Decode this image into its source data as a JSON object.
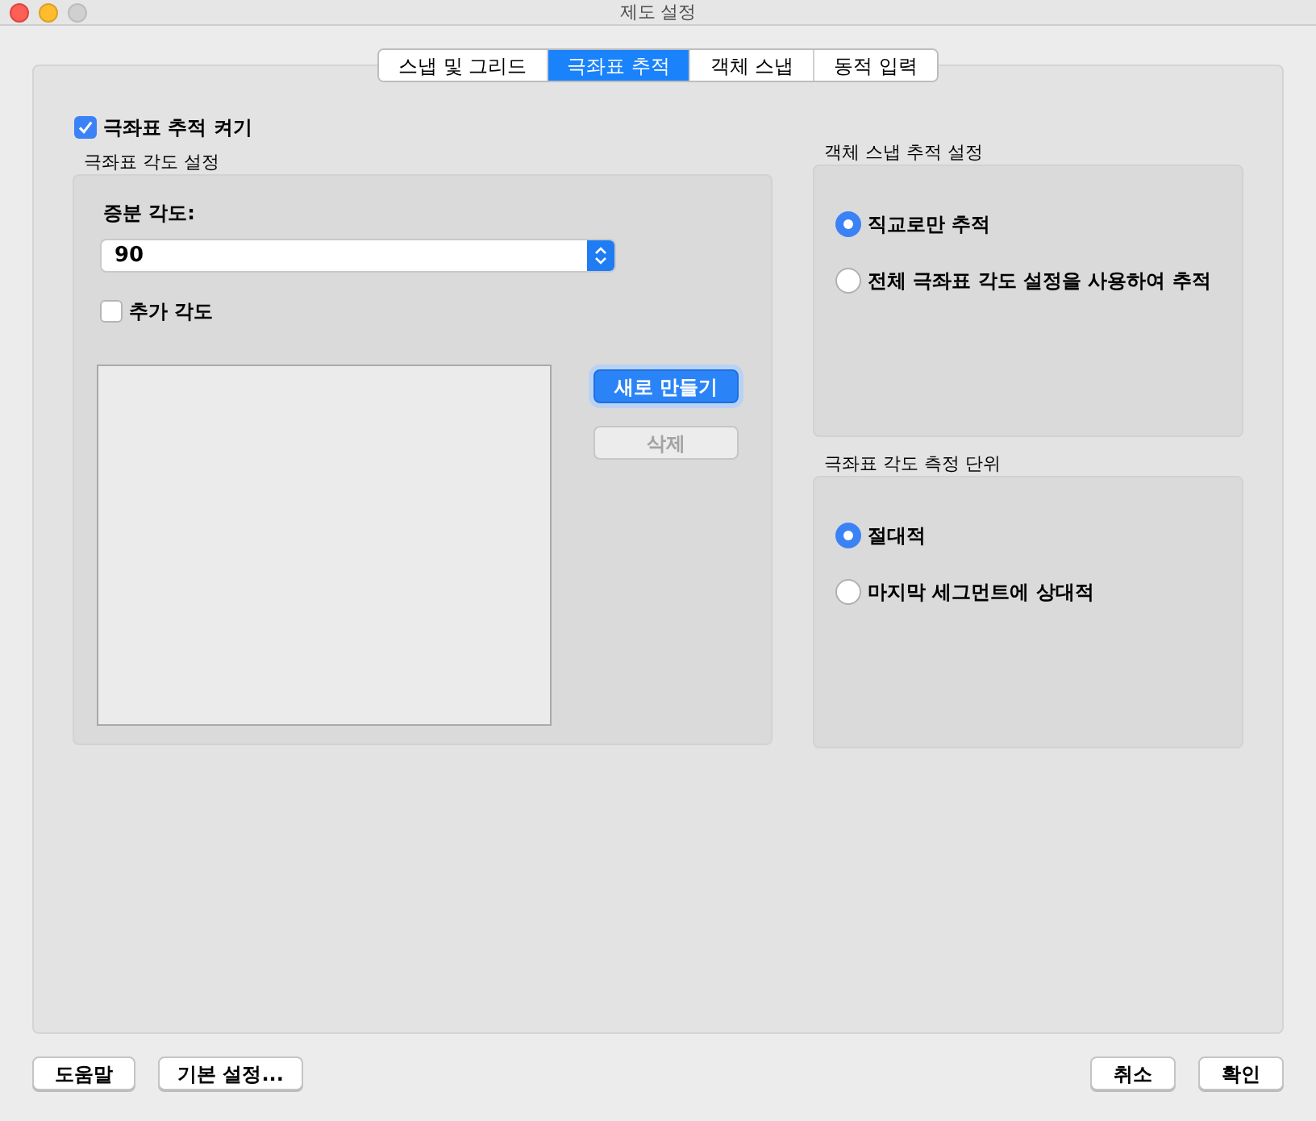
{
  "window": {
    "title": "제도 설정"
  },
  "tabs": [
    {
      "label": "스냅 및 그리드",
      "selected": false
    },
    {
      "label": "극좌표 추적",
      "selected": true
    },
    {
      "label": "객체 스냅",
      "selected": false
    },
    {
      "label": "동적 입력",
      "selected": false
    }
  ],
  "enable_checkbox": {
    "label": "극좌표 추적 켜기",
    "checked": true
  },
  "angle_group": {
    "title": "극좌표 각도 설정",
    "increment_label": "증분 각도:",
    "increment_value": "90",
    "additional_checkbox": {
      "label": "추가 각도",
      "checked": false
    },
    "buttons": [
      {
        "label": "새로 만들기",
        "default": true,
        "disabled": false
      },
      {
        "label": "삭제",
        "default": false,
        "disabled": true
      }
    ]
  },
  "object_snap_group": {
    "title": "객체 스냅 추적 설정",
    "options": [
      {
        "label": "직교로만 추적",
        "selected": true
      },
      {
        "label": "전체 극좌표 각도 설정을 사용하여 추적",
        "selected": false
      }
    ]
  },
  "measurement_group": {
    "title": "극좌표 각도 측정 단위",
    "options": [
      {
        "label": "절대적",
        "selected": true
      },
      {
        "label": "마지막 세그먼트에 상대적",
        "selected": false
      }
    ]
  },
  "footer_left_buttons": [
    "도움말",
    "기본 설정..."
  ],
  "footer_right_buttons": [
    "취소",
    "확인"
  ]
}
